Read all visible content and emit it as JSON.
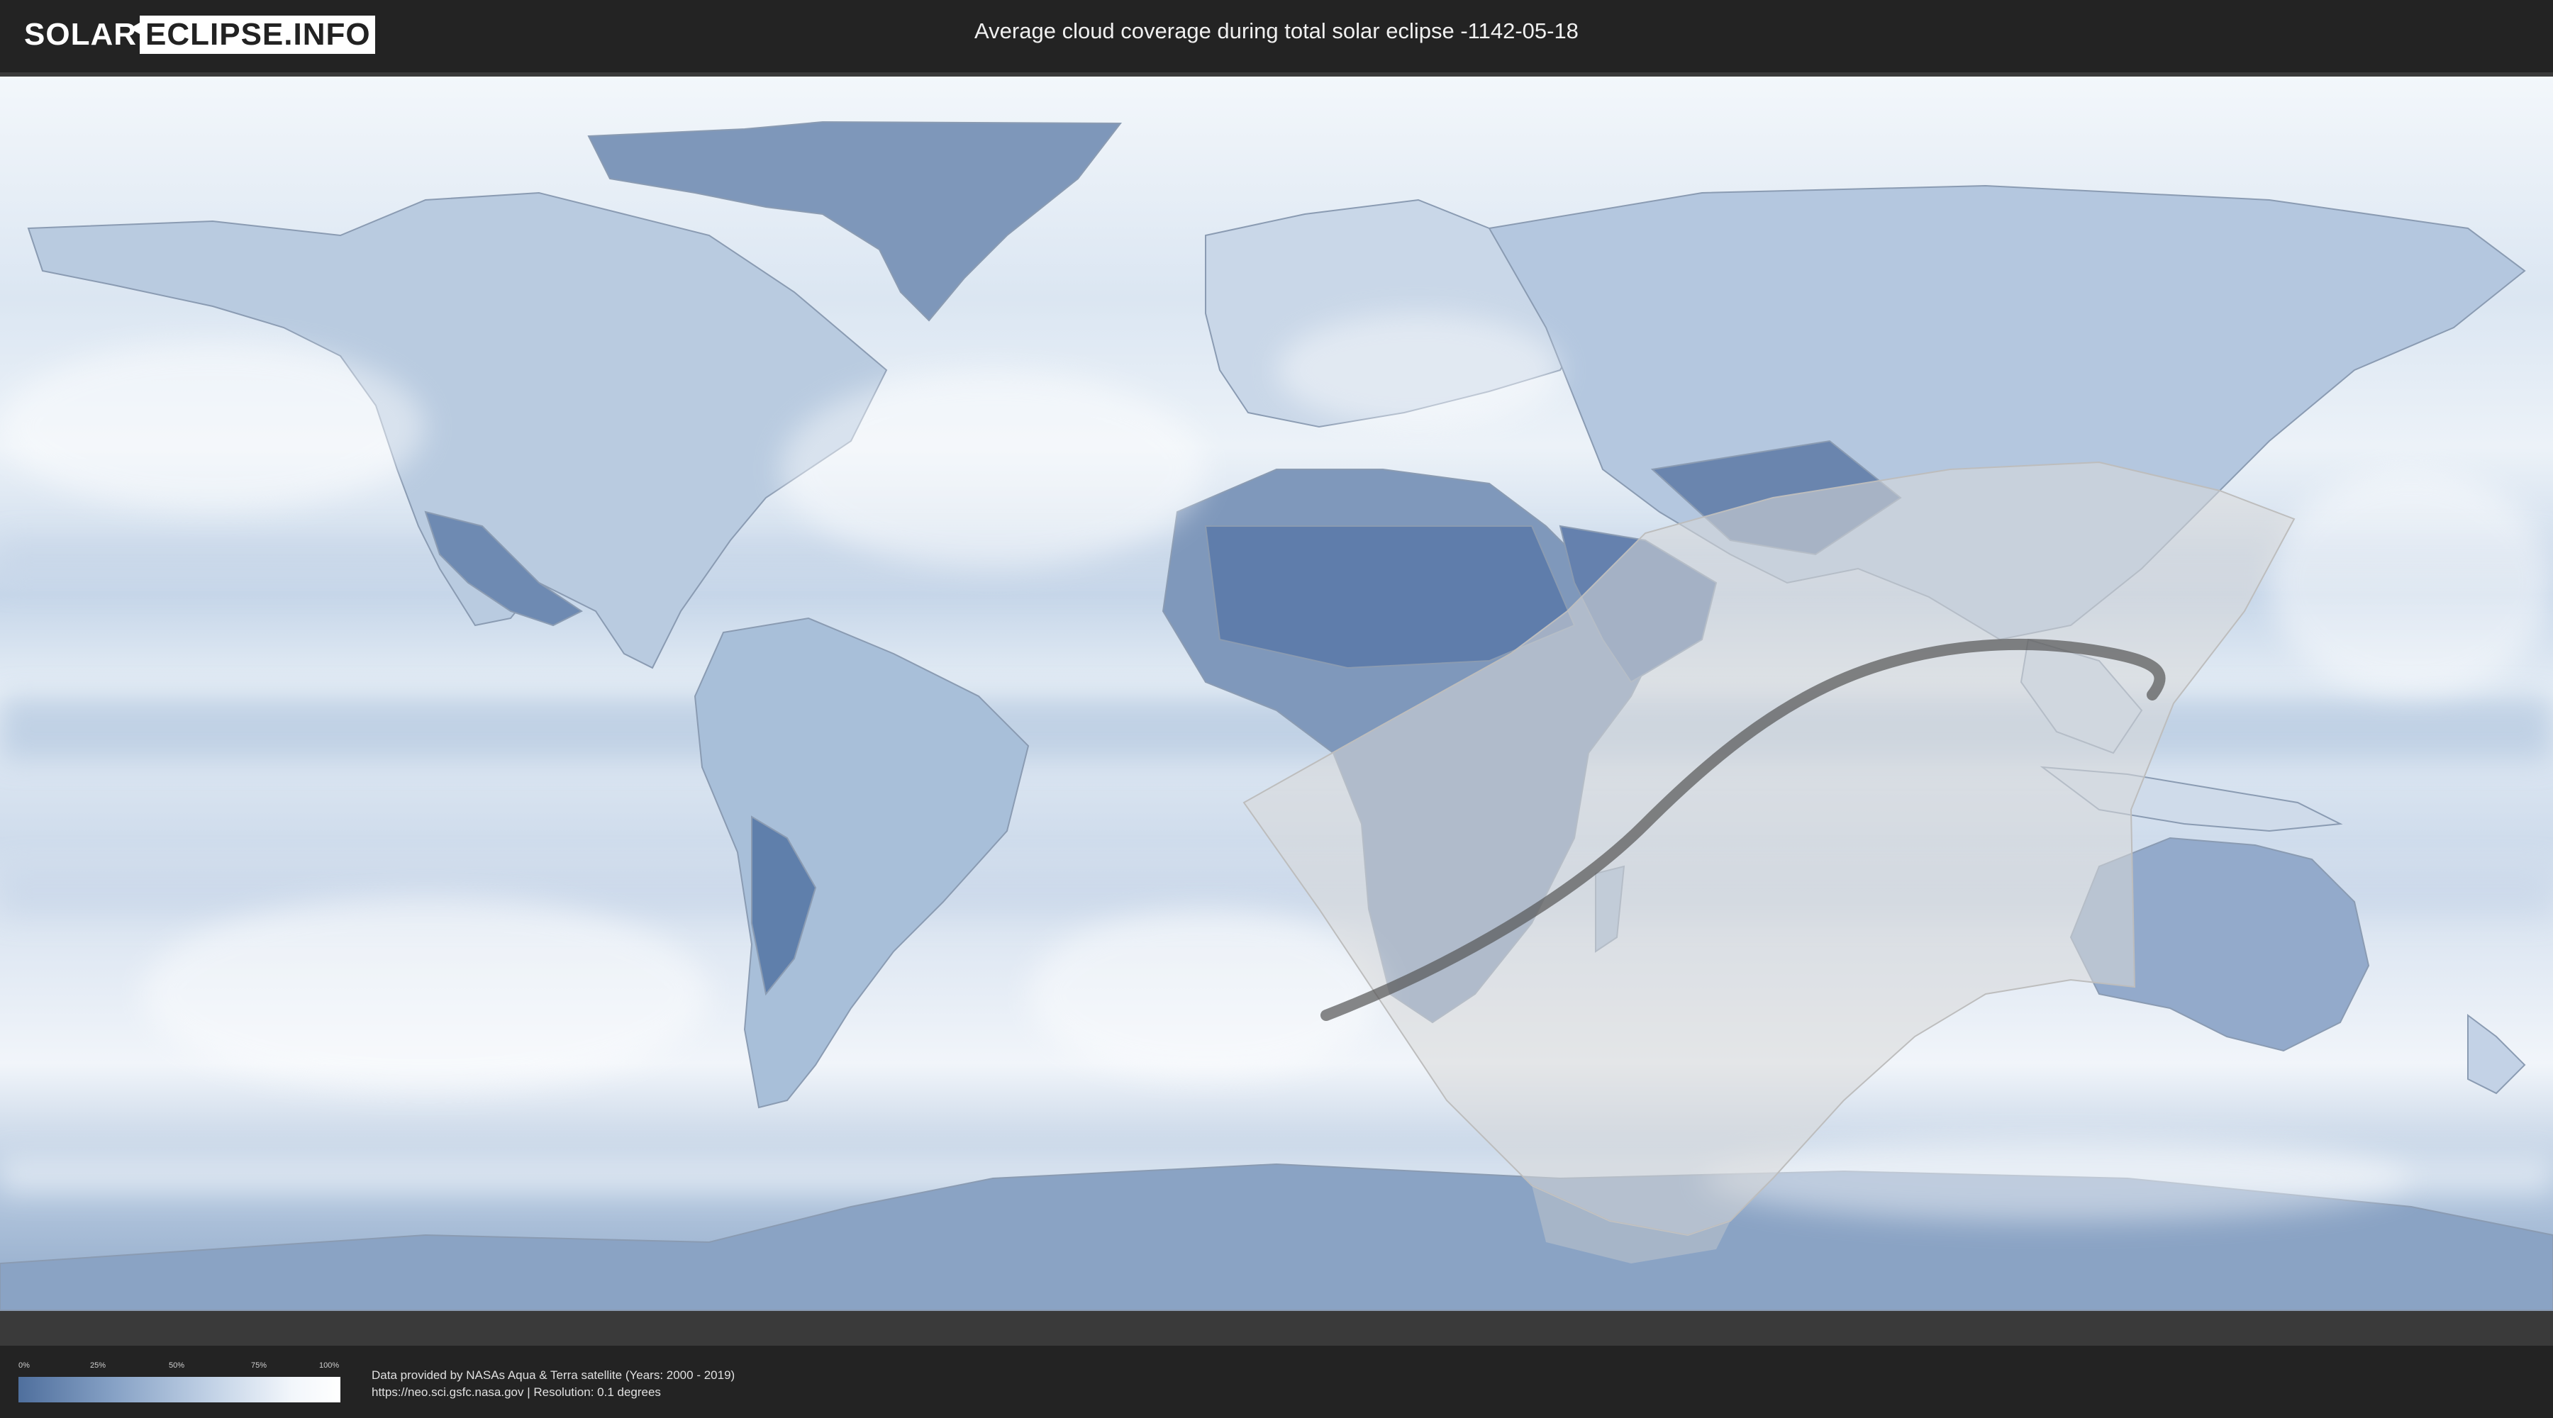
{
  "header": {
    "logo": {
      "left_text": "SOLAR",
      "right_text": "ECLIPSE.INFO"
    },
    "title": "Average cloud coverage during total solar eclipse -1142-05-18"
  },
  "map": {
    "layers": [
      "cloud-coverage-basemap",
      "country-borders",
      "eclipse-visibility-zone",
      "totality-path"
    ],
    "colors": {
      "clear": "#4f6f9d",
      "cloudy": "#ffffff",
      "visibility_zone": "#d9d9d9",
      "totality_path": "#6b6b6b",
      "borders": "#8898ae"
    }
  },
  "footer": {
    "legend": {
      "ticks": [
        "0%",
        "25%",
        "50%",
        "75%",
        "100%"
      ],
      "gradient": [
        "#4f6f9d",
        "#87a2c6",
        "#c2d2e6",
        "#f2f6fb",
        "#ffffff"
      ]
    },
    "credit": {
      "line1": "Data provided by NASAs Aqua & Terra satellite (Years: 2000 - 2019)",
      "line2": "https://neo.sci.gsfc.nasa.gov | Resolution: 0.1 degrees"
    }
  }
}
